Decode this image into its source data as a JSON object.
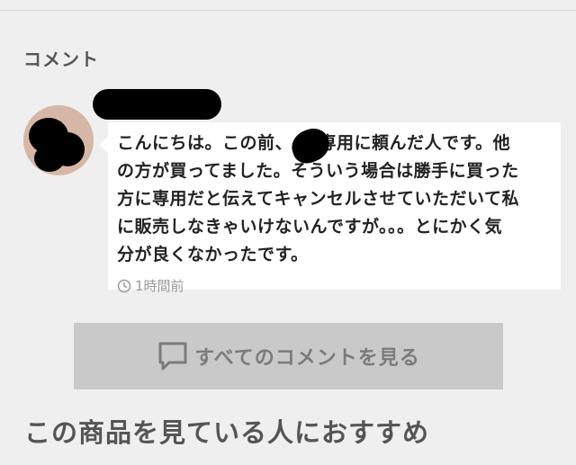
{
  "comments_section": {
    "label": "コメント"
  },
  "comment": {
    "text": "こんにちは。この前、　を専用に頼んだ人です。他\nの方が買ってました。そういう場合は勝手に買った\n方に専用だと伝えてキャンセルさせていただいて私\nに販売しなきゃいけないんですが。。。とにかく気\n分が良くなかったです。",
    "time": "1時間前",
    "time_icon": "clock-icon"
  },
  "view_all": {
    "label": "すべてのコメントを見る",
    "icon": "comment-icon"
  },
  "recommend": {
    "title": "この商品を見ている人におすすめ"
  },
  "colors": {
    "background": "#efefef",
    "bubble": "#ffffff",
    "button": "#c9c9c9",
    "muted_text": "#9a9a9a"
  }
}
